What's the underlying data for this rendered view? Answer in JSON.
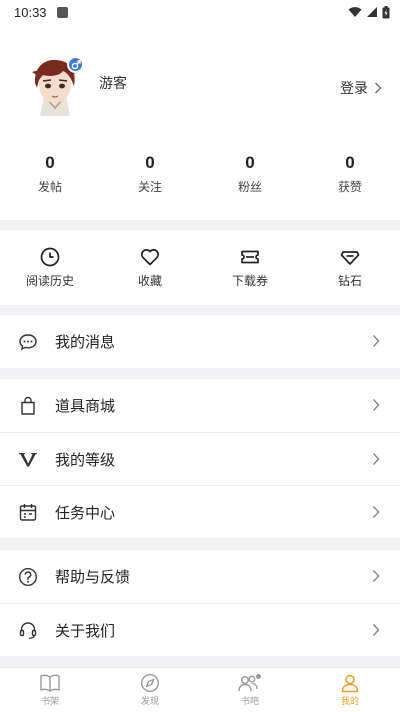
{
  "status_bar": {
    "time": "10:33"
  },
  "profile": {
    "username": "游客",
    "login_label": "登录",
    "stats": [
      {
        "value": "0",
        "label": "发帖"
      },
      {
        "value": "0",
        "label": "关注"
      },
      {
        "value": "0",
        "label": "粉丝"
      },
      {
        "value": "0",
        "label": "获赞"
      }
    ]
  },
  "quick_actions": [
    {
      "label": "阅读历史",
      "icon": "clock-icon"
    },
    {
      "label": "收藏",
      "icon": "heart-icon"
    },
    {
      "label": "下载券",
      "icon": "ticket-icon"
    },
    {
      "label": "钻石",
      "icon": "diamond-icon"
    }
  ],
  "menu": {
    "messages": {
      "label": "我的消息",
      "icon": "chat-icon"
    },
    "shop": {
      "label": "道具商城",
      "icon": "shopping-bag-icon"
    },
    "level": {
      "label": "我的等级",
      "icon": "vip-v-icon"
    },
    "tasks": {
      "label": "任务中心",
      "icon": "calendar-icon"
    },
    "help": {
      "label": "帮助与反馈",
      "icon": "question-icon"
    },
    "about": {
      "label": "关于我们",
      "icon": "headset-icon"
    }
  },
  "tabbar": [
    {
      "label": "书架",
      "icon": "book-icon",
      "active": false
    },
    {
      "label": "发现",
      "icon": "compass-icon",
      "active": false
    },
    {
      "label": "书吧",
      "icon": "community-icon",
      "active": false
    },
    {
      "label": "我的",
      "icon": "person-icon",
      "active": true
    }
  ],
  "colors": {
    "accent": "#f39c2b",
    "badge": "#3a7bd5",
    "divider": "#f2f2f4"
  }
}
